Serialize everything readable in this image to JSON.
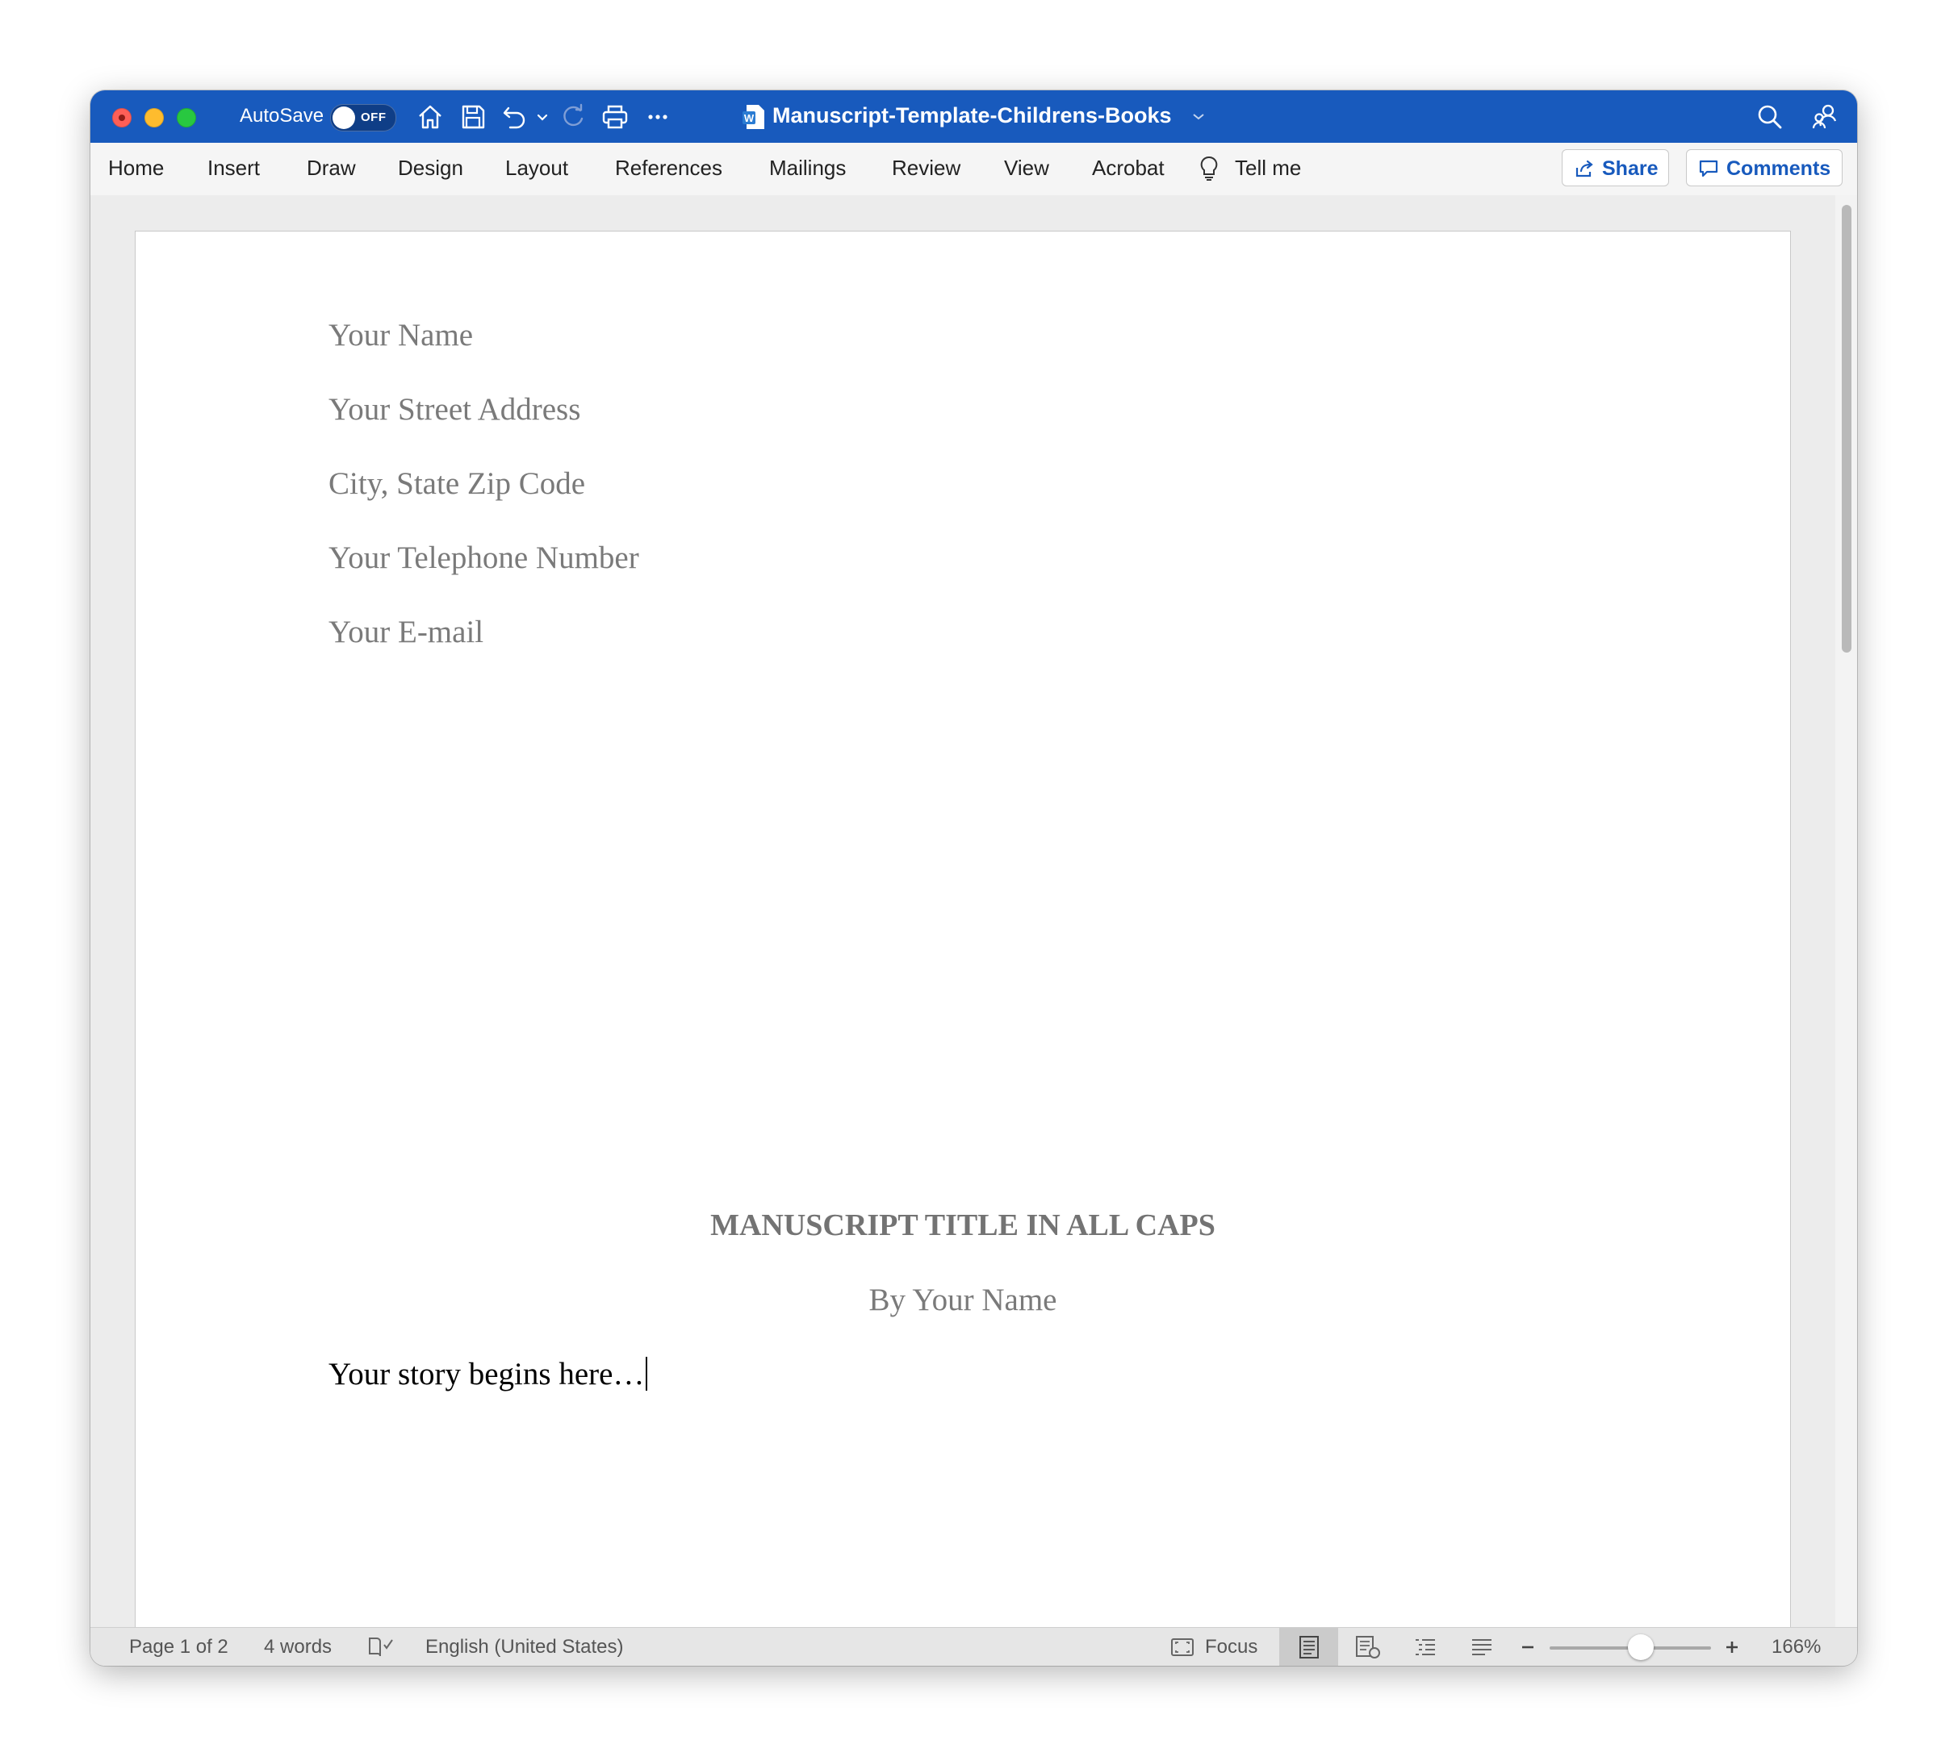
{
  "titlebar": {
    "autosave_label": "AutoSave",
    "autosave_state": "OFF",
    "document_title": "Manuscript-Template-Childrens-Books",
    "accent": "#185abd"
  },
  "ribbon": {
    "tabs": [
      "Home",
      "Insert",
      "Draw",
      "Design",
      "Layout",
      "References",
      "Mailings",
      "Review",
      "View",
      "Acrobat"
    ],
    "tell_me": "Tell me",
    "share_label": "Share",
    "comments_label": "Comments"
  },
  "document": {
    "contact": {
      "name": "Your Name",
      "street": "Your Street Address",
      "city": "City, State Zip Code",
      "phone": "Your Telephone Number",
      "email": "Your E-mail"
    },
    "title": "MANUSCRIPT TITLE IN ALL CAPS",
    "byline": "By Your Name",
    "story_start": "Your story begins here…"
  },
  "statusbar": {
    "page": "Page 1 of 2",
    "words": "4 words",
    "language": "English (United States)",
    "focus": "Focus",
    "zoom": "166%"
  },
  "icons": {
    "home": "home-icon",
    "save": "save-icon",
    "undo": "undo-icon",
    "redo": "redo-icon",
    "print": "print-icon",
    "more": "more-icon",
    "search": "search-icon",
    "share_people": "share-people-icon",
    "lightbulb": "lightbulb-icon"
  }
}
